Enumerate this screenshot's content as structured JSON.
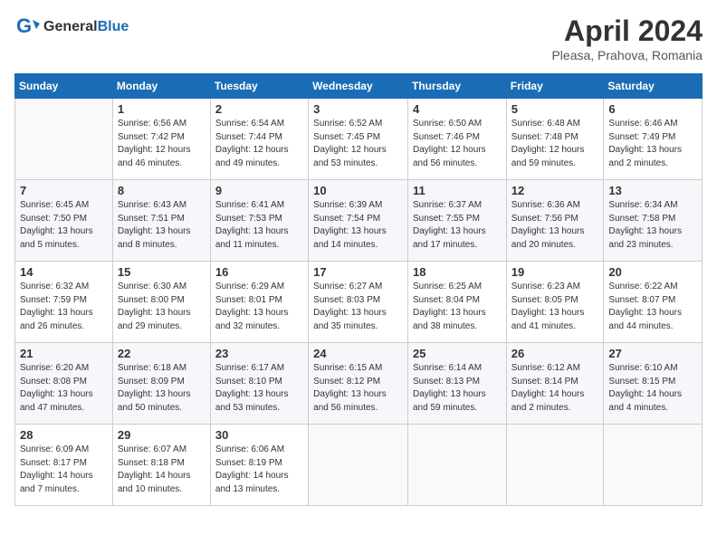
{
  "header": {
    "logo_general": "General",
    "logo_blue": "Blue",
    "month_year": "April 2024",
    "location": "Pleasa, Prahova, Romania"
  },
  "weekdays": [
    "Sunday",
    "Monday",
    "Tuesday",
    "Wednesday",
    "Thursday",
    "Friday",
    "Saturday"
  ],
  "weeks": [
    [
      {
        "day": "",
        "sunrise": "",
        "sunset": "",
        "daylight": ""
      },
      {
        "day": "1",
        "sunrise": "Sunrise: 6:56 AM",
        "sunset": "Sunset: 7:42 PM",
        "daylight": "Daylight: 12 hours and 46 minutes."
      },
      {
        "day": "2",
        "sunrise": "Sunrise: 6:54 AM",
        "sunset": "Sunset: 7:44 PM",
        "daylight": "Daylight: 12 hours and 49 minutes."
      },
      {
        "day": "3",
        "sunrise": "Sunrise: 6:52 AM",
        "sunset": "Sunset: 7:45 PM",
        "daylight": "Daylight: 12 hours and 53 minutes."
      },
      {
        "day": "4",
        "sunrise": "Sunrise: 6:50 AM",
        "sunset": "Sunset: 7:46 PM",
        "daylight": "Daylight: 12 hours and 56 minutes."
      },
      {
        "day": "5",
        "sunrise": "Sunrise: 6:48 AM",
        "sunset": "Sunset: 7:48 PM",
        "daylight": "Daylight: 12 hours and 59 minutes."
      },
      {
        "day": "6",
        "sunrise": "Sunrise: 6:46 AM",
        "sunset": "Sunset: 7:49 PM",
        "daylight": "Daylight: 13 hours and 2 minutes."
      }
    ],
    [
      {
        "day": "7",
        "sunrise": "Sunrise: 6:45 AM",
        "sunset": "Sunset: 7:50 PM",
        "daylight": "Daylight: 13 hours and 5 minutes."
      },
      {
        "day": "8",
        "sunrise": "Sunrise: 6:43 AM",
        "sunset": "Sunset: 7:51 PM",
        "daylight": "Daylight: 13 hours and 8 minutes."
      },
      {
        "day": "9",
        "sunrise": "Sunrise: 6:41 AM",
        "sunset": "Sunset: 7:53 PM",
        "daylight": "Daylight: 13 hours and 11 minutes."
      },
      {
        "day": "10",
        "sunrise": "Sunrise: 6:39 AM",
        "sunset": "Sunset: 7:54 PM",
        "daylight": "Daylight: 13 hours and 14 minutes."
      },
      {
        "day": "11",
        "sunrise": "Sunrise: 6:37 AM",
        "sunset": "Sunset: 7:55 PM",
        "daylight": "Daylight: 13 hours and 17 minutes."
      },
      {
        "day": "12",
        "sunrise": "Sunrise: 6:36 AM",
        "sunset": "Sunset: 7:56 PM",
        "daylight": "Daylight: 13 hours and 20 minutes."
      },
      {
        "day": "13",
        "sunrise": "Sunrise: 6:34 AM",
        "sunset": "Sunset: 7:58 PM",
        "daylight": "Daylight: 13 hours and 23 minutes."
      }
    ],
    [
      {
        "day": "14",
        "sunrise": "Sunrise: 6:32 AM",
        "sunset": "Sunset: 7:59 PM",
        "daylight": "Daylight: 13 hours and 26 minutes."
      },
      {
        "day": "15",
        "sunrise": "Sunrise: 6:30 AM",
        "sunset": "Sunset: 8:00 PM",
        "daylight": "Daylight: 13 hours and 29 minutes."
      },
      {
        "day": "16",
        "sunrise": "Sunrise: 6:29 AM",
        "sunset": "Sunset: 8:01 PM",
        "daylight": "Daylight: 13 hours and 32 minutes."
      },
      {
        "day": "17",
        "sunrise": "Sunrise: 6:27 AM",
        "sunset": "Sunset: 8:03 PM",
        "daylight": "Daylight: 13 hours and 35 minutes."
      },
      {
        "day": "18",
        "sunrise": "Sunrise: 6:25 AM",
        "sunset": "Sunset: 8:04 PM",
        "daylight": "Daylight: 13 hours and 38 minutes."
      },
      {
        "day": "19",
        "sunrise": "Sunrise: 6:23 AM",
        "sunset": "Sunset: 8:05 PM",
        "daylight": "Daylight: 13 hours and 41 minutes."
      },
      {
        "day": "20",
        "sunrise": "Sunrise: 6:22 AM",
        "sunset": "Sunset: 8:07 PM",
        "daylight": "Daylight: 13 hours and 44 minutes."
      }
    ],
    [
      {
        "day": "21",
        "sunrise": "Sunrise: 6:20 AM",
        "sunset": "Sunset: 8:08 PM",
        "daylight": "Daylight: 13 hours and 47 minutes."
      },
      {
        "day": "22",
        "sunrise": "Sunrise: 6:18 AM",
        "sunset": "Sunset: 8:09 PM",
        "daylight": "Daylight: 13 hours and 50 minutes."
      },
      {
        "day": "23",
        "sunrise": "Sunrise: 6:17 AM",
        "sunset": "Sunset: 8:10 PM",
        "daylight": "Daylight: 13 hours and 53 minutes."
      },
      {
        "day": "24",
        "sunrise": "Sunrise: 6:15 AM",
        "sunset": "Sunset: 8:12 PM",
        "daylight": "Daylight: 13 hours and 56 minutes."
      },
      {
        "day": "25",
        "sunrise": "Sunrise: 6:14 AM",
        "sunset": "Sunset: 8:13 PM",
        "daylight": "Daylight: 13 hours and 59 minutes."
      },
      {
        "day": "26",
        "sunrise": "Sunrise: 6:12 AM",
        "sunset": "Sunset: 8:14 PM",
        "daylight": "Daylight: 14 hours and 2 minutes."
      },
      {
        "day": "27",
        "sunrise": "Sunrise: 6:10 AM",
        "sunset": "Sunset: 8:15 PM",
        "daylight": "Daylight: 14 hours and 4 minutes."
      }
    ],
    [
      {
        "day": "28",
        "sunrise": "Sunrise: 6:09 AM",
        "sunset": "Sunset: 8:17 PM",
        "daylight": "Daylight: 14 hours and 7 minutes."
      },
      {
        "day": "29",
        "sunrise": "Sunrise: 6:07 AM",
        "sunset": "Sunset: 8:18 PM",
        "daylight": "Daylight: 14 hours and 10 minutes."
      },
      {
        "day": "30",
        "sunrise": "Sunrise: 6:06 AM",
        "sunset": "Sunset: 8:19 PM",
        "daylight": "Daylight: 14 hours and 13 minutes."
      },
      {
        "day": "",
        "sunrise": "",
        "sunset": "",
        "daylight": ""
      },
      {
        "day": "",
        "sunrise": "",
        "sunset": "",
        "daylight": ""
      },
      {
        "day": "",
        "sunrise": "",
        "sunset": "",
        "daylight": ""
      },
      {
        "day": "",
        "sunrise": "",
        "sunset": "",
        "daylight": ""
      }
    ]
  ]
}
